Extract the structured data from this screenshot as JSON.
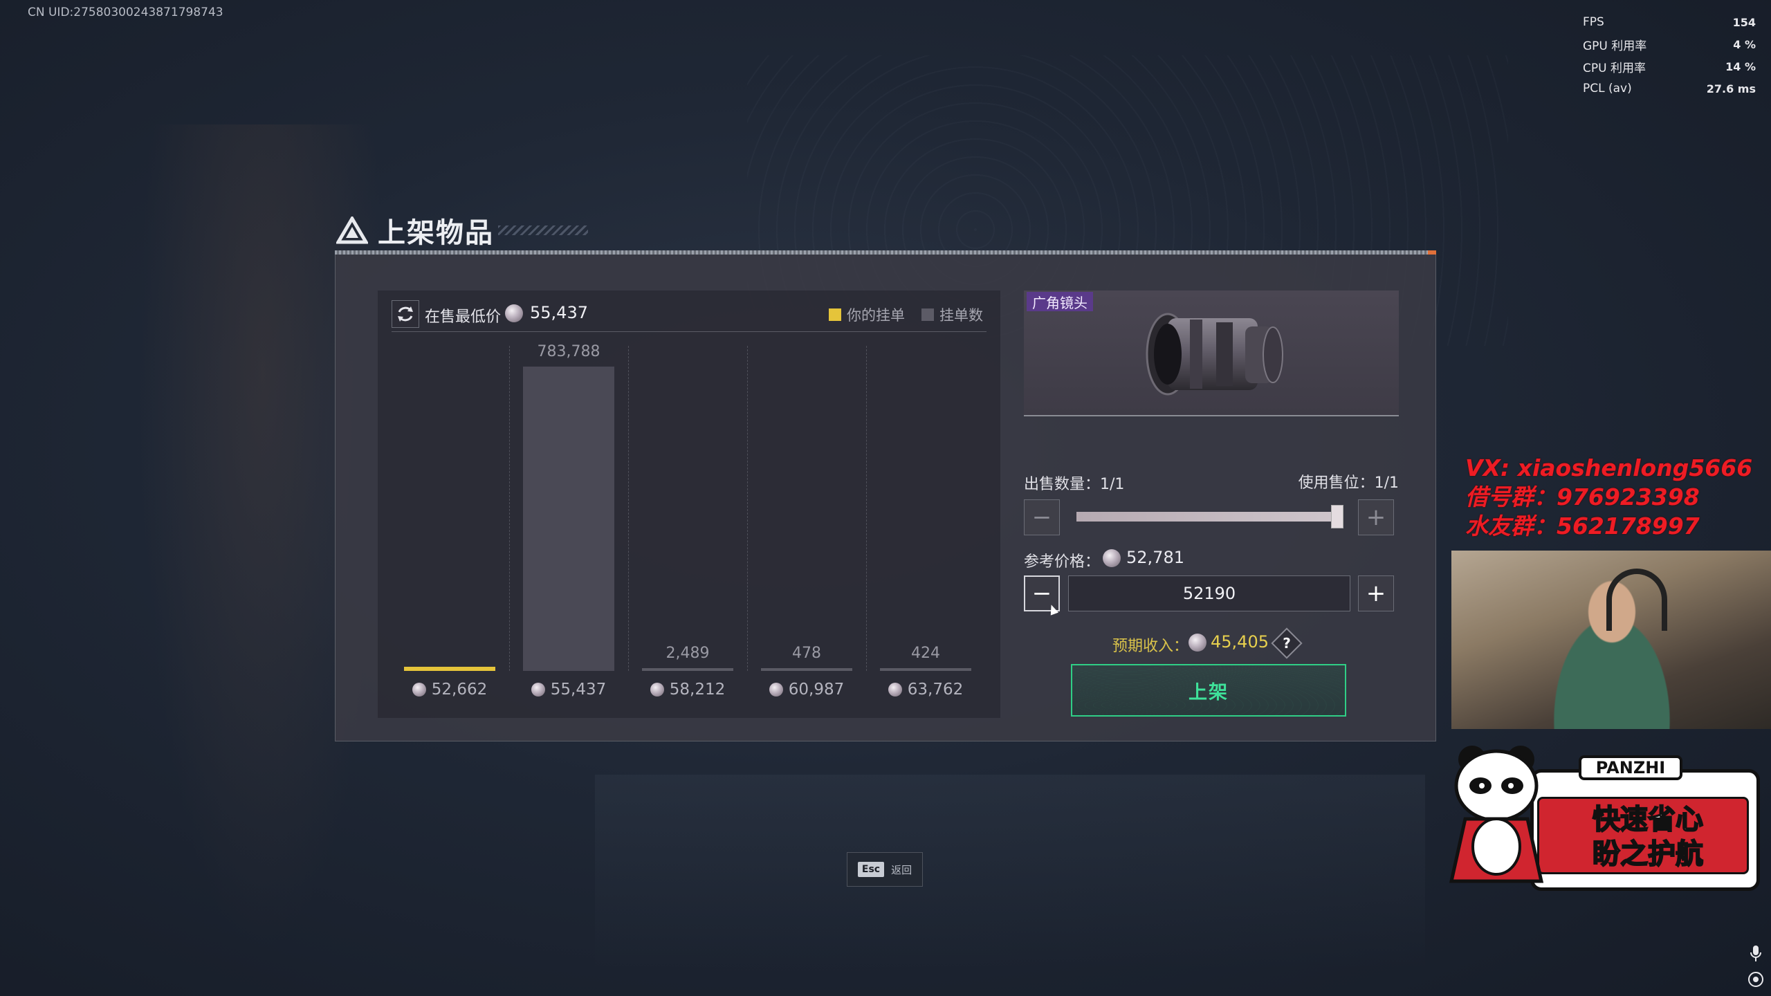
{
  "overlay": {
    "uid": "CN UID:27580300243871798743",
    "perf": [
      {
        "label": "FPS",
        "value": "154"
      },
      {
        "label": "GPU 利用率",
        "value": "4 %"
      },
      {
        "label": "CPU 利用率",
        "value": "14 %"
      },
      {
        "label": "PCL (av)",
        "value": "27.6 ms"
      }
    ]
  },
  "dialog": {
    "title": "上架物品",
    "chart": {
      "lowest_label": "在售最低价",
      "lowest_value": "55,437",
      "legend_you": "你的挂单",
      "legend_count": "挂单数",
      "legend_you_color": "#e5c43a",
      "legend_count_color": "#5c5b66"
    },
    "item": {
      "tag": "广角镜头"
    },
    "quantity": {
      "label": "出售数量：1/1",
      "slot_label": "使用售位：1/1",
      "minus": "−",
      "plus": "+",
      "fraction": 1.0
    },
    "price": {
      "ref_label": "参考价格：",
      "ref_value": "52,781",
      "input_value": "52190",
      "minus": "−",
      "plus": "+"
    },
    "income": {
      "label": "预期收入：",
      "value": "45,405",
      "help": "?"
    },
    "list_button": "上架",
    "esc": {
      "key": "Esc",
      "label": "返回"
    }
  },
  "chart_data": {
    "type": "bar",
    "categories": [
      "52,662",
      "55,437",
      "58,212",
      "60,987",
      "63,762"
    ],
    "series": [
      {
        "name": "你的挂单",
        "values": [
          1,
          0,
          0,
          0,
          0
        ]
      },
      {
        "name": "挂单数",
        "values": [
          null,
          783788,
          2489,
          478,
          424
        ]
      }
    ],
    "value_labels": [
      "",
      "783,788",
      "2,489",
      "478",
      "424"
    ],
    "ylim": [
      0,
      783788
    ]
  },
  "stream": {
    "promo_lines": [
      "VX: xiaoshenlong5666",
      "借号群：976923398",
      "水友群：562178997"
    ],
    "badge_title": "PANZHI",
    "badge_line1": "快速省心",
    "badge_line2": "盼之护航"
  }
}
